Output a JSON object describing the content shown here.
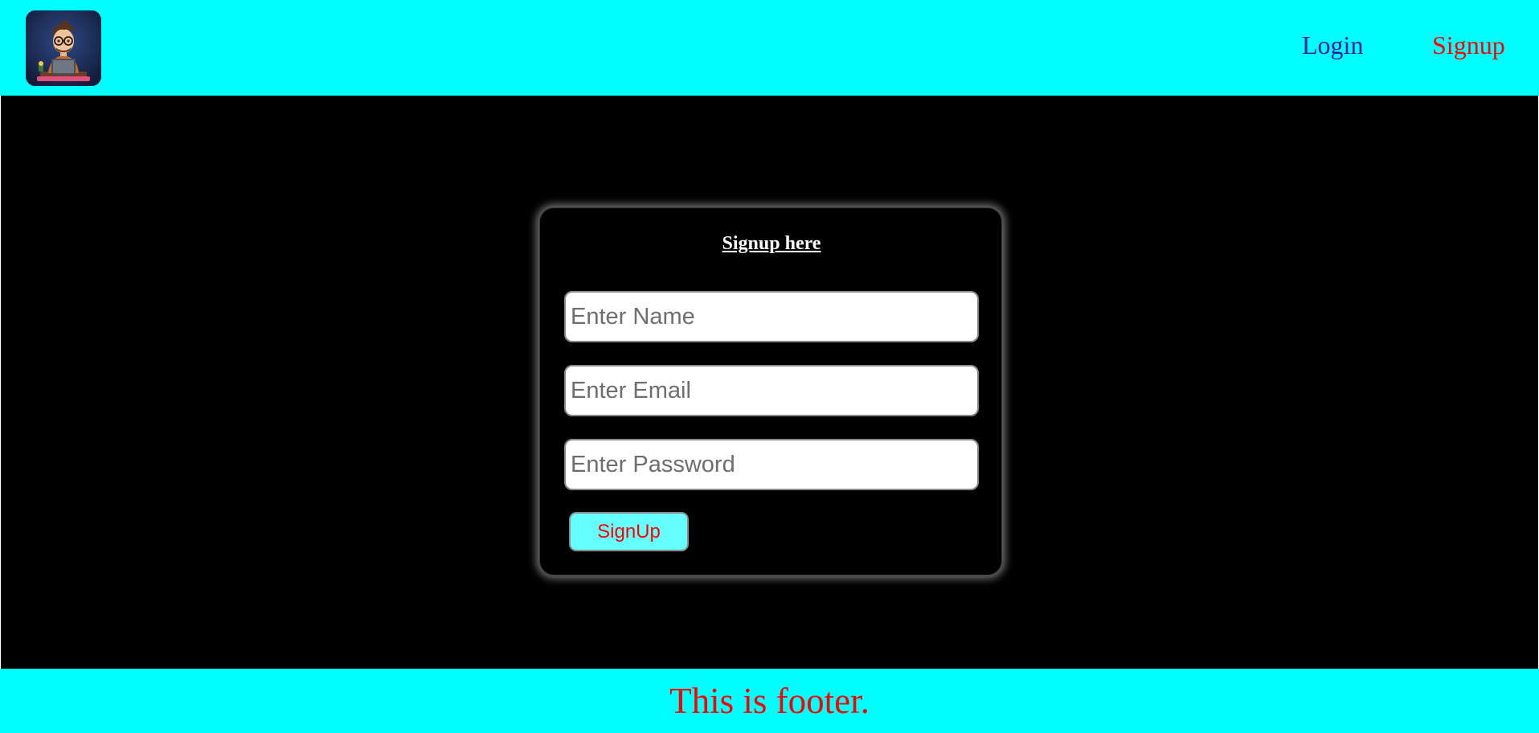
{
  "header": {
    "logo_icon": "developer-avatar-logo-icon",
    "nav": {
      "login_label": "Login",
      "signup_label": "Signup"
    }
  },
  "signup_form": {
    "title": "Signup here",
    "name_placeholder": "Enter Name",
    "email_placeholder": "Enter Email",
    "password_placeholder": "Enter Password",
    "submit_label": "SignUp"
  },
  "footer": {
    "text": "This is footer."
  },
  "colors": {
    "header_bg": "#00ffff",
    "main_bg": "#000000",
    "login_link": "#1a1aa6",
    "signup_link": "#ff0000",
    "button_bg": "#66ffff",
    "footer_text": "#ff0000"
  }
}
